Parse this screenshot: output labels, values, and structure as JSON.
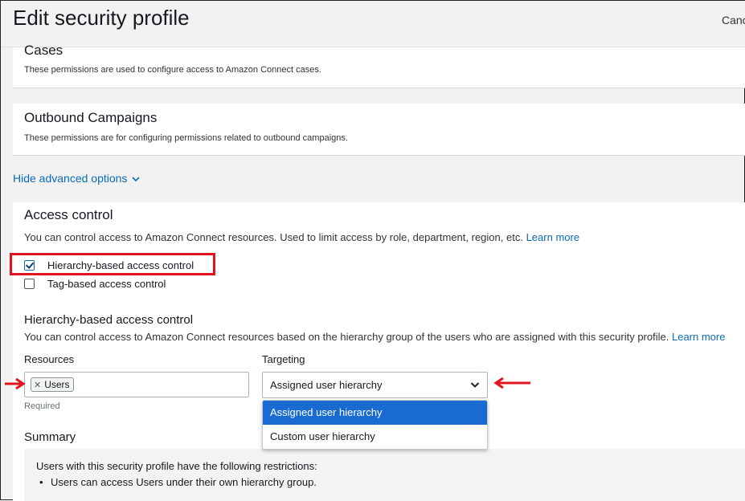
{
  "header": {
    "title": "Edit security profile",
    "cancel_label": "Canc"
  },
  "cases": {
    "title": "Cases",
    "description": "These permissions are used to configure access to Amazon Connect cases."
  },
  "outbound": {
    "title": "Outbound Campaigns",
    "description": "These permissions are for configuring permissions related to outbound campaigns."
  },
  "advanced_toggle": {
    "label": "Hide advanced options",
    "icon": "chevron-down-icon"
  },
  "access_control": {
    "title": "Access control",
    "description": "You can control access to Amazon Connect resources. Used to limit access by role, department, region, etc.",
    "learn_more": "Learn more",
    "options": [
      {
        "label": "Hierarchy-based access control",
        "checked": true
      },
      {
        "label": "Tag-based access control",
        "checked": false
      }
    ]
  },
  "hierarchy": {
    "title": "Hierarchy-based access control",
    "description": "You can control access to Amazon Connect resources based on the hierarchy group of the users who are assigned with this security profile.",
    "learn_more": "Learn more",
    "resources_label": "Resources",
    "resources_tokens": [
      "Users"
    ],
    "required_hint": "Required",
    "targeting_label": "Targeting",
    "targeting_value": "Assigned user hierarchy",
    "targeting_options": [
      "Assigned user hierarchy",
      "Custom user hierarchy"
    ],
    "selected_option_index": 0
  },
  "summary": {
    "title": "Summary",
    "intro": "Users with this security profile have the following restrictions:",
    "items": [
      "Users can access Users under their own hierarchy group."
    ]
  },
  "colors": {
    "link": "#0a6bb8",
    "highlight_red": "#e0141e",
    "selected_option": "#1a6bd1"
  }
}
